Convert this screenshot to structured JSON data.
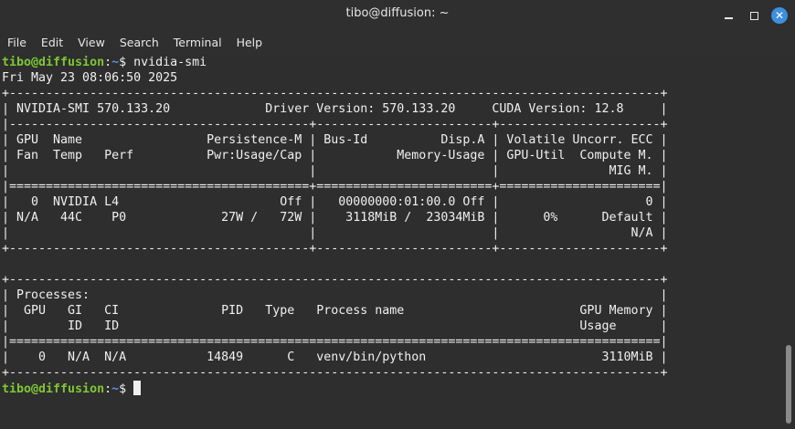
{
  "window": {
    "title": "tibo@diffusion: ~",
    "minimize_icon": "minimize-icon",
    "maximize_icon": "maximize-icon",
    "close_icon": "close-icon",
    "close_glyph": "✕",
    "accent_color": "#3d8fe0"
  },
  "menu": [
    "File",
    "Edit",
    "View",
    "Search",
    "Terminal",
    "Help"
  ],
  "prompt": {
    "user_host": "tibo@diffusion",
    "colon": ":",
    "path": "~",
    "symbol": "$ ",
    "user_color": "#7ec734",
    "path_color": "#5c8ff0"
  },
  "terminal": {
    "command": "nvidia-smi",
    "output_lines": [
      "Fri May 23 08:06:50 2025",
      "+-----------------------------------------------------------------------------------------+",
      "| NVIDIA-SMI 570.133.20             Driver Version: 570.133.20     CUDA Version: 12.8     |",
      "|-----------------------------------------+------------------------+----------------------+",
      "| GPU  Name                 Persistence-M | Bus-Id          Disp.A | Volatile Uncorr. ECC |",
      "| Fan  Temp   Perf          Pwr:Usage/Cap |           Memory-Usage | GPU-Util  Compute M. |",
      "|                                         |                        |               MIG M. |",
      "|=========================================+========================+======================|",
      "|   0  NVIDIA L4                      Off |   00000000:01:00.0 Off |                    0 |",
      "| N/A   44C    P0             27W /   72W |    3118MiB /  23034MiB |      0%      Default |",
      "|                                         |                        |                  N/A |",
      "+-----------------------------------------+------------------------+----------------------+",
      "",
      "+-----------------------------------------------------------------------------------------+",
      "| Processes:                                                                              |",
      "|  GPU   GI   CI              PID   Type   Process name                        GPU Memory |",
      "|        ID   ID                                                               Usage      |",
      "|=========================================================================================|",
      "|    0   N/A  N/A           14849      C   venv/bin/python                        3110MiB |",
      "+-----------------------------------------------------------------------------------------+"
    ]
  }
}
